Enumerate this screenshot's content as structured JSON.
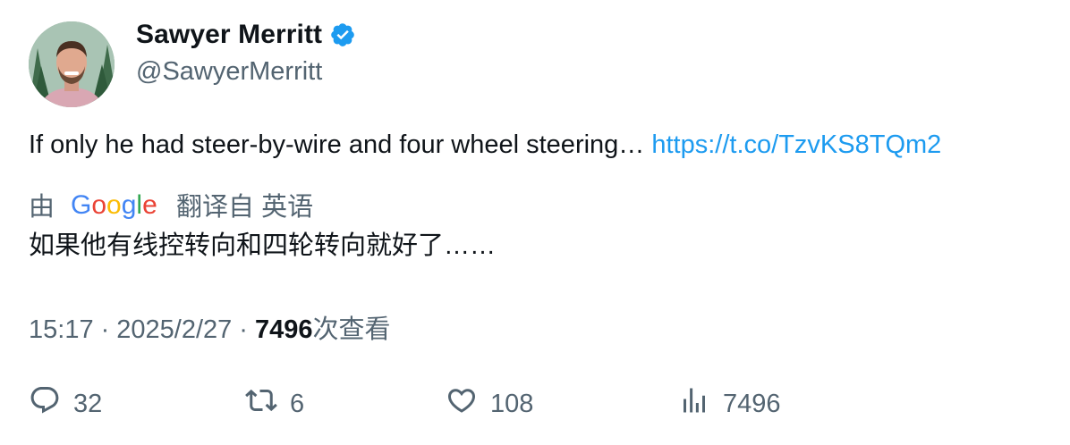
{
  "author": {
    "display_name": "Sawyer Merritt",
    "handle": "@SawyerMerritt",
    "verified": true,
    "verified_color": "#1d9bf0"
  },
  "tweet": {
    "text": "If only he had steer-by-wire and four wheel steering… ",
    "link": "https://t.co/TzvKS8TQm2",
    "link_color": "#1d9bf0"
  },
  "translation": {
    "prefix": "由",
    "provider_logo": "Google",
    "suffix": "翻译自 英语",
    "text": "如果他有线控转向和四轮转向就好了……"
  },
  "meta": {
    "time": "15:17",
    "separator": "·",
    "date": "2025/2/27",
    "views": "7496",
    "views_label": "次查看"
  },
  "actions": {
    "replies": "32",
    "retweets": "6",
    "likes": "108",
    "views": "7496"
  },
  "icons": {
    "reply": "speech-bubble-icon",
    "retweet": "retweet-arrows-icon",
    "like": "heart-icon",
    "views": "bar-chart-icon",
    "verified": "verified-badge-icon"
  }
}
